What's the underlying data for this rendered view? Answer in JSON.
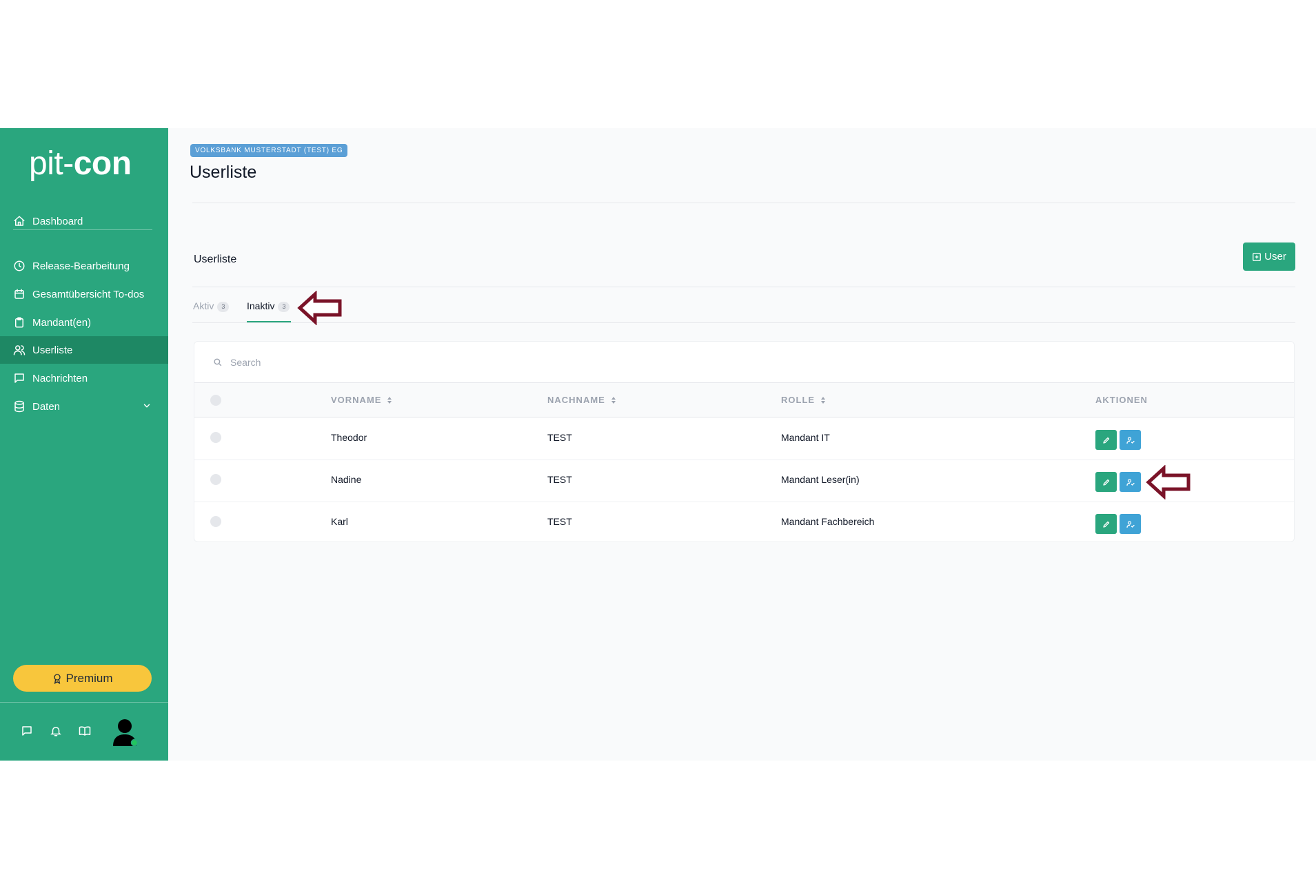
{
  "logo": {
    "light": "pit-",
    "bold": "con"
  },
  "sidebar": {
    "items": [
      {
        "label": "Dashboard",
        "icon": "home-icon"
      },
      {
        "label": "Release-Bearbeitung",
        "icon": "clock-icon"
      },
      {
        "label": "Gesamtübersicht To-dos",
        "icon": "calendar-icon"
      },
      {
        "label": "Mandant(en)",
        "icon": "clipboard-icon"
      },
      {
        "label": "Userliste",
        "icon": "users-icon",
        "active": true
      },
      {
        "label": "Nachrichten",
        "icon": "chat-icon"
      },
      {
        "label": "Daten",
        "icon": "database-icon"
      }
    ],
    "premium_label": "Premium"
  },
  "header": {
    "org_badge": "VOLKSBANK MUSTERSTADT (TEST) EG",
    "title": "Userliste"
  },
  "section": {
    "title": "Userliste",
    "add_button_label": "User"
  },
  "tabs": [
    {
      "label": "Aktiv",
      "count": "3"
    },
    {
      "label": "Inaktiv",
      "count": "3",
      "selected": true
    }
  ],
  "search": {
    "placeholder": "Search",
    "value": ""
  },
  "table": {
    "columns": [
      "VORNAME",
      "NACHNAME",
      "ROLLE",
      "AKTIONEN"
    ],
    "rows": [
      {
        "vorname": "Theodor",
        "nachname": "TEST",
        "rolle": "Mandant IT"
      },
      {
        "vorname": "Nadine",
        "nachname": "TEST",
        "rolle": "Mandant Leser(in)"
      },
      {
        "vorname": "Karl",
        "nachname": "TEST",
        "rolle": "Mandant Fachbereich"
      }
    ]
  },
  "colors": {
    "brand": "#2aa67e",
    "brand_dark": "#1e8864",
    "premium": "#f8c63c",
    "info": "#3fa3d6",
    "annotation_arrow": "#7a1328"
  }
}
